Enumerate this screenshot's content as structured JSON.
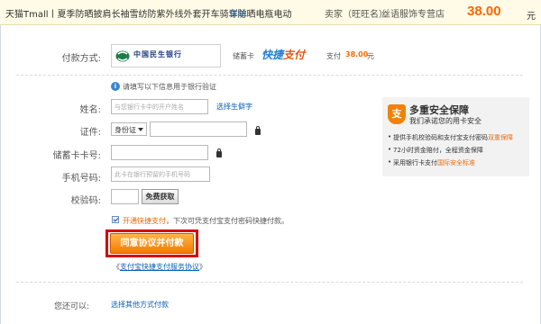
{
  "header": {
    "order_title": "天猫Tmall丨夏季防晒披肩长袖雪纺防紫外线外套开车骑车防晒电瓶电动",
    "detail_link": "详单",
    "seller_label": "卖家（旺旺名）：",
    "seller_name": "丝语服饰专营店",
    "amount": "38.00",
    "amount_unit": "元"
  },
  "payment_method": {
    "label": "付款方式:",
    "bank_name": "中国民生银行",
    "card_type": "储蓄卡",
    "express_logo_a": "快捷",
    "express_logo_b": "支付",
    "pay_label": "支付",
    "pay_amount": "38.00",
    "pay_unit": "元"
  },
  "form": {
    "tip": "请填写以下信息用于银行验证",
    "name_label": "姓名:",
    "name_placeholder": "与您银行卡中的开户姓名",
    "name_link": "选择生僻字",
    "id_label": "证件:",
    "id_type": "身份证",
    "card_label": "储蓄卡卡号:",
    "phone_label": "手机号码:",
    "phone_placeholder": "此卡在银行预留的手机号码",
    "code_label": "校验码:",
    "code_button": "免费获取"
  },
  "express": {
    "opt_in": "开通快捷支付",
    "opt_in_rest": "，下次可凭支付宝支付密码快捷付款。",
    "submit": "同意协议并付款",
    "agreement_prefix": "《",
    "agreement_link": "支付宝快捷支付服务协议",
    "agreement_suffix": "》"
  },
  "other": {
    "label": "您还可以:",
    "link": "选择其他方式付款"
  },
  "security": {
    "badge": "支",
    "title": "多重安全保障",
    "subtitle": "我们承诺您的用卡安全",
    "item1": "提供手机校验码和支付宝支付密码",
    "item1_highlight": "双重保障",
    "item2": "72小时资金赔付，全程资金保障",
    "item3": "采用银行卡支付",
    "item3_highlight": "国际安全标准"
  },
  "colors": {
    "accent": "#ff6600",
    "link": "#0a5fb4",
    "highlight_frame": "#d40000"
  }
}
